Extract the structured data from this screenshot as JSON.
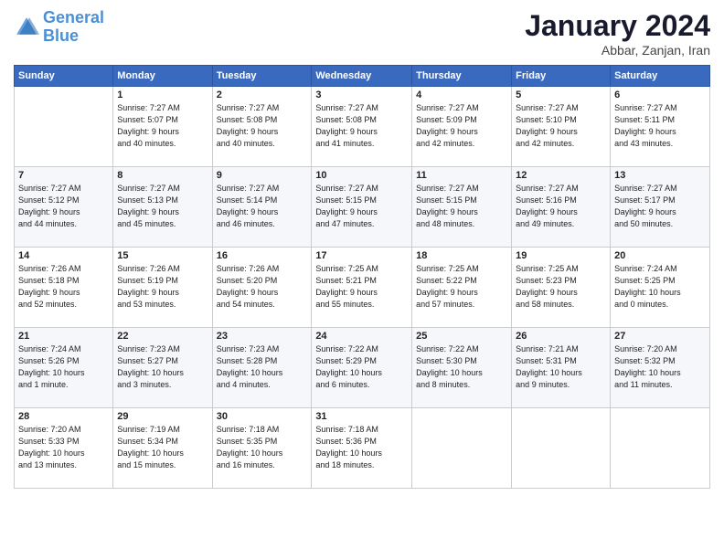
{
  "logo": {
    "line1": "General",
    "line2": "Blue"
  },
  "title": "January 2024",
  "location": "Abbar, Zanjan, Iran",
  "days_header": [
    "Sunday",
    "Monday",
    "Tuesday",
    "Wednesday",
    "Thursday",
    "Friday",
    "Saturday"
  ],
  "weeks": [
    [
      {
        "day": "",
        "info": ""
      },
      {
        "day": "1",
        "info": "Sunrise: 7:27 AM\nSunset: 5:07 PM\nDaylight: 9 hours\nand 40 minutes."
      },
      {
        "day": "2",
        "info": "Sunrise: 7:27 AM\nSunset: 5:08 PM\nDaylight: 9 hours\nand 40 minutes."
      },
      {
        "day": "3",
        "info": "Sunrise: 7:27 AM\nSunset: 5:08 PM\nDaylight: 9 hours\nand 41 minutes."
      },
      {
        "day": "4",
        "info": "Sunrise: 7:27 AM\nSunset: 5:09 PM\nDaylight: 9 hours\nand 42 minutes."
      },
      {
        "day": "5",
        "info": "Sunrise: 7:27 AM\nSunset: 5:10 PM\nDaylight: 9 hours\nand 42 minutes."
      },
      {
        "day": "6",
        "info": "Sunrise: 7:27 AM\nSunset: 5:11 PM\nDaylight: 9 hours\nand 43 minutes."
      }
    ],
    [
      {
        "day": "7",
        "info": "Sunrise: 7:27 AM\nSunset: 5:12 PM\nDaylight: 9 hours\nand 44 minutes."
      },
      {
        "day": "8",
        "info": "Sunrise: 7:27 AM\nSunset: 5:13 PM\nDaylight: 9 hours\nand 45 minutes."
      },
      {
        "day": "9",
        "info": "Sunrise: 7:27 AM\nSunset: 5:14 PM\nDaylight: 9 hours\nand 46 minutes."
      },
      {
        "day": "10",
        "info": "Sunrise: 7:27 AM\nSunset: 5:15 PM\nDaylight: 9 hours\nand 47 minutes."
      },
      {
        "day": "11",
        "info": "Sunrise: 7:27 AM\nSunset: 5:15 PM\nDaylight: 9 hours\nand 48 minutes."
      },
      {
        "day": "12",
        "info": "Sunrise: 7:27 AM\nSunset: 5:16 PM\nDaylight: 9 hours\nand 49 minutes."
      },
      {
        "day": "13",
        "info": "Sunrise: 7:27 AM\nSunset: 5:17 PM\nDaylight: 9 hours\nand 50 minutes."
      }
    ],
    [
      {
        "day": "14",
        "info": "Sunrise: 7:26 AM\nSunset: 5:18 PM\nDaylight: 9 hours\nand 52 minutes."
      },
      {
        "day": "15",
        "info": "Sunrise: 7:26 AM\nSunset: 5:19 PM\nDaylight: 9 hours\nand 53 minutes."
      },
      {
        "day": "16",
        "info": "Sunrise: 7:26 AM\nSunset: 5:20 PM\nDaylight: 9 hours\nand 54 minutes."
      },
      {
        "day": "17",
        "info": "Sunrise: 7:25 AM\nSunset: 5:21 PM\nDaylight: 9 hours\nand 55 minutes."
      },
      {
        "day": "18",
        "info": "Sunrise: 7:25 AM\nSunset: 5:22 PM\nDaylight: 9 hours\nand 57 minutes."
      },
      {
        "day": "19",
        "info": "Sunrise: 7:25 AM\nSunset: 5:23 PM\nDaylight: 9 hours\nand 58 minutes."
      },
      {
        "day": "20",
        "info": "Sunrise: 7:24 AM\nSunset: 5:25 PM\nDaylight: 10 hours\nand 0 minutes."
      }
    ],
    [
      {
        "day": "21",
        "info": "Sunrise: 7:24 AM\nSunset: 5:26 PM\nDaylight: 10 hours\nand 1 minute."
      },
      {
        "day": "22",
        "info": "Sunrise: 7:23 AM\nSunset: 5:27 PM\nDaylight: 10 hours\nand 3 minutes."
      },
      {
        "day": "23",
        "info": "Sunrise: 7:23 AM\nSunset: 5:28 PM\nDaylight: 10 hours\nand 4 minutes."
      },
      {
        "day": "24",
        "info": "Sunrise: 7:22 AM\nSunset: 5:29 PM\nDaylight: 10 hours\nand 6 minutes."
      },
      {
        "day": "25",
        "info": "Sunrise: 7:22 AM\nSunset: 5:30 PM\nDaylight: 10 hours\nand 8 minutes."
      },
      {
        "day": "26",
        "info": "Sunrise: 7:21 AM\nSunset: 5:31 PM\nDaylight: 10 hours\nand 9 minutes."
      },
      {
        "day": "27",
        "info": "Sunrise: 7:20 AM\nSunset: 5:32 PM\nDaylight: 10 hours\nand 11 minutes."
      }
    ],
    [
      {
        "day": "28",
        "info": "Sunrise: 7:20 AM\nSunset: 5:33 PM\nDaylight: 10 hours\nand 13 minutes."
      },
      {
        "day": "29",
        "info": "Sunrise: 7:19 AM\nSunset: 5:34 PM\nDaylight: 10 hours\nand 15 minutes."
      },
      {
        "day": "30",
        "info": "Sunrise: 7:18 AM\nSunset: 5:35 PM\nDaylight: 10 hours\nand 16 minutes."
      },
      {
        "day": "31",
        "info": "Sunrise: 7:18 AM\nSunset: 5:36 PM\nDaylight: 10 hours\nand 18 minutes."
      },
      {
        "day": "",
        "info": ""
      },
      {
        "day": "",
        "info": ""
      },
      {
        "day": "",
        "info": ""
      }
    ]
  ]
}
